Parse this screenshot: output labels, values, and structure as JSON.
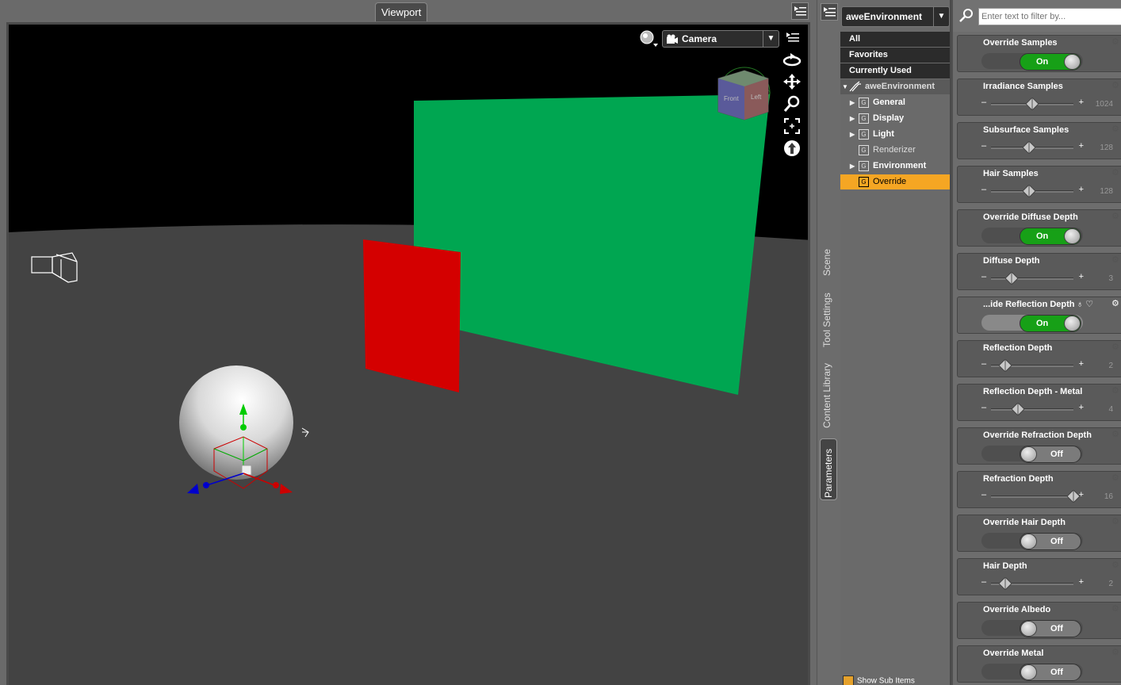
{
  "viewport": {
    "tab_label": "Viewport",
    "camera_label": "Camera",
    "gizmo_faces": [
      "Front",
      "Left"
    ],
    "colors": {
      "background": "#000000",
      "floor": "#434343",
      "green_plane": "#00a651",
      "red_plane": "#d40000"
    }
  },
  "side_tabs": [
    "Scene",
    "Tool Settings",
    "Content Library",
    "Parameters"
  ],
  "categories": {
    "node_name": "aweEnvironment",
    "fixed": [
      "All",
      "Favorites",
      "Currently Used"
    ],
    "tree_root": "aweEnvironment",
    "tree": [
      {
        "label": "General",
        "expandable": true,
        "selected": false
      },
      {
        "label": "Display",
        "expandable": true,
        "selected": false
      },
      {
        "label": "Light",
        "expandable": true,
        "selected": false
      },
      {
        "label": "Renderizer",
        "expandable": false,
        "selected": false
      },
      {
        "label": "Environment",
        "expandable": true,
        "selected": false
      },
      {
        "label": "Override",
        "expandable": false,
        "selected": true
      }
    ],
    "show_sub_items": "Show Sub Items",
    "selected_color": "#f5a623"
  },
  "params": {
    "filter_placeholder": "Enter text to filter by...",
    "items": [
      {
        "title": "Override Samples",
        "type": "toggle",
        "state": "On"
      },
      {
        "title": "Irradiance Samples",
        "type": "slider",
        "value": "1024",
        "position": 0.5
      },
      {
        "title": "Subsurface Samples",
        "type": "slider",
        "value": "128",
        "position": 0.46
      },
      {
        "title": "Hair Samples",
        "type": "slider",
        "value": "128",
        "position": 0.46
      },
      {
        "title": "Override Diffuse Depth",
        "type": "toggle",
        "state": "On"
      },
      {
        "title": "Diffuse Depth",
        "type": "slider",
        "value": "3",
        "position": 0.25
      },
      {
        "title": "...ide Reflection Depth",
        "type": "toggle",
        "state": "On",
        "hover": true
      },
      {
        "title": "Reflection Depth",
        "type": "slider",
        "value": "2",
        "position": 0.17
      },
      {
        "title": "Reflection Depth - Metal",
        "type": "slider",
        "value": "4",
        "position": 0.33
      },
      {
        "title": "Override Refraction Depth",
        "type": "toggle",
        "state": "Off"
      },
      {
        "title": "Refraction Depth",
        "type": "slider",
        "value": "16",
        "position": 1.0
      },
      {
        "title": "Override Hair Depth",
        "type": "toggle",
        "state": "Off"
      },
      {
        "title": "Hair Depth",
        "type": "slider",
        "value": "2",
        "position": 0.17
      },
      {
        "title": "Override Albedo",
        "type": "toggle",
        "state": "Off"
      },
      {
        "title": "Override Metal",
        "type": "toggle",
        "state": "Off"
      }
    ]
  }
}
